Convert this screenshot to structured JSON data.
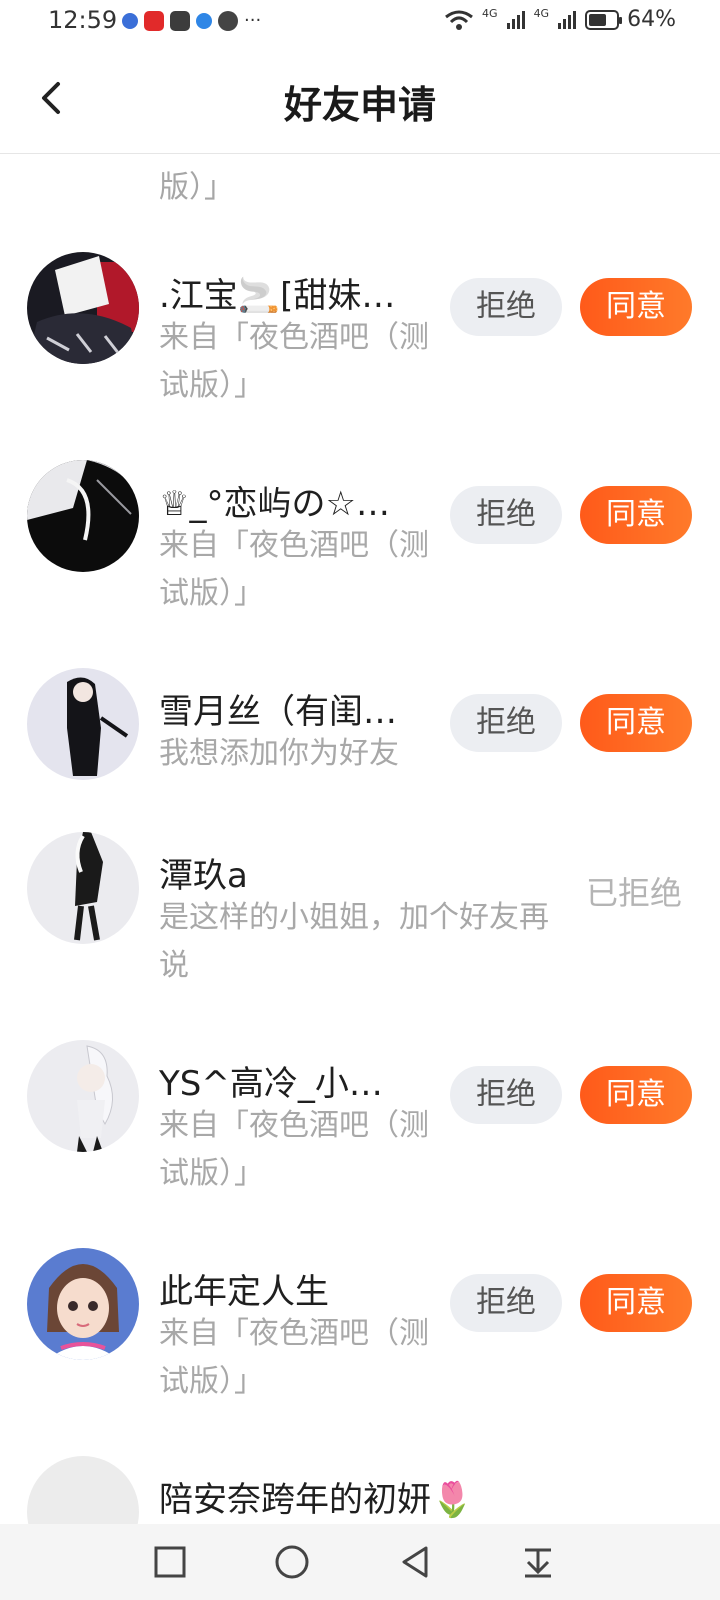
{
  "status_bar": {
    "time": "12:59",
    "more": "···",
    "network_a": "4G",
    "network_b": "4G",
    "battery_level": 0.64,
    "battery_text": "64%"
  },
  "header": {
    "title": "好友申请",
    "back_icon": "chevron-left-icon"
  },
  "list": {
    "partial_top_sub": "版）」",
    "reject_label": "拒绝",
    "agree_label": "同意",
    "rejected_label": "已拒绝",
    "items": [
      {
        "name": ".江宝🚬[甜妹…",
        "sub": "来自「夜色酒吧（测试版）」"
      },
      {
        "name": "♕_°恋屿の☆…",
        "sub": "来自「夜色酒吧（测试版）」"
      },
      {
        "name": "雪月丝（有闺…",
        "sub": "我想添加你为好友"
      },
      {
        "name": "潭玖a",
        "sub": "是这样的小姐姐，加个好友再说",
        "status": "已拒绝"
      },
      {
        "name": "YS^高冷_小…",
        "sub": "来自「夜色酒吧（测试版）」"
      },
      {
        "name": "此年定人生",
        "sub": "来自「夜色酒吧（测试版）」"
      }
    ],
    "partial_bottom_name": "陪安奈跨年的初妍🌷"
  },
  "navbar": {
    "icons": [
      "square-icon",
      "circle-icon",
      "triangle-back-icon",
      "download-icon"
    ]
  },
  "colors": {
    "accent": "#ff5a1a",
    "reject_bg": "#eceef2",
    "sub_text": "#a8a8a8"
  }
}
